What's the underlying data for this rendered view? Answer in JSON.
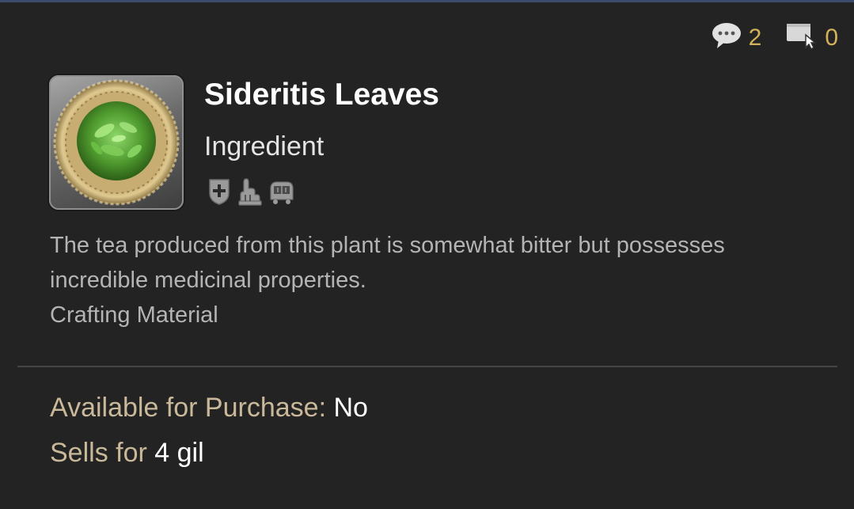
{
  "counters": {
    "comments": "2",
    "macros": "0"
  },
  "item": {
    "name": "Sideritis Leaves",
    "category": "Ingredient",
    "icon": "basket-of-green-leaves-icon",
    "job_icons": [
      "shield-plus-icon",
      "hand-icon",
      "cart-icon"
    ]
  },
  "description": {
    "line1": "The tea produced from this plant is somewhat bitter but possesses",
    "line2": "incredible medicinal properties.",
    "line3": "Crafting Material"
  },
  "purchase": {
    "label": "Available for Purchase:",
    "value": "No"
  },
  "sells": {
    "label": "Sells for",
    "value": "4 gil"
  },
  "colors": {
    "background": "#232323",
    "counter_number": "#d4b25a",
    "label_tan": "#c9b899",
    "description_gray": "#b4b4b4"
  }
}
